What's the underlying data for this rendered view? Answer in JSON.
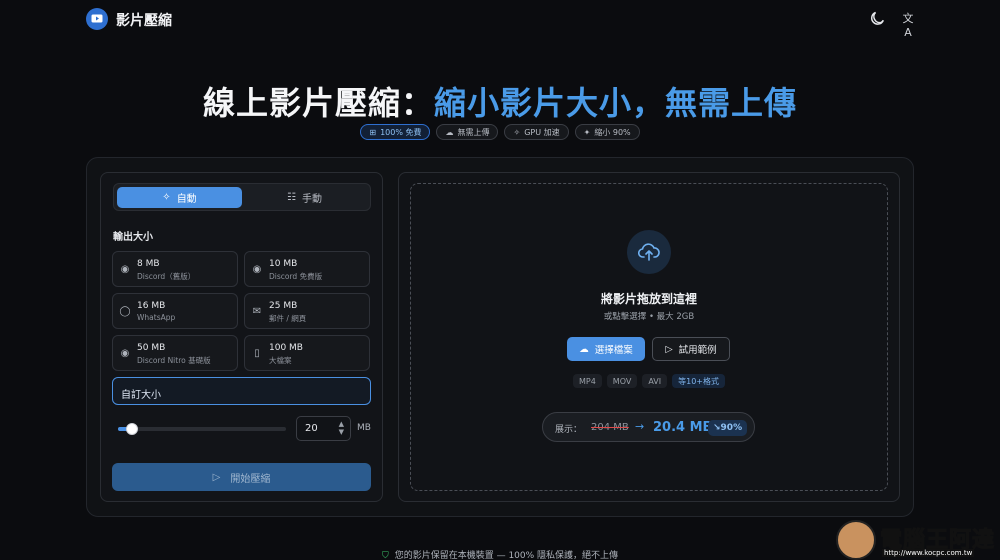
{
  "header": {
    "app_name": "影片壓縮"
  },
  "hero": {
    "title_white": "線上影片壓縮：",
    "title_blue": "縮小影片大小，無需上傳"
  },
  "badges": [
    {
      "icon": "gift-icon",
      "glyph": "⊞",
      "label": "100% 免費"
    },
    {
      "icon": "cloud-off-icon",
      "glyph": "☁",
      "label": "無需上傳"
    },
    {
      "icon": "cpu-icon",
      "glyph": "✧",
      "label": "GPU 加速"
    },
    {
      "icon": "sparkle-icon",
      "glyph": "✦",
      "label": "縮小 90%"
    }
  ],
  "mode": {
    "auto_label": "自動",
    "manual_label": "手動"
  },
  "output": {
    "title": "輸出大小",
    "options": [
      {
        "icon": "discord-icon",
        "glyph": "◉",
        "size": "8 MB",
        "desc": "Discord（舊版）"
      },
      {
        "icon": "discord-icon",
        "glyph": "◉",
        "size": "10 MB",
        "desc": "Discord 免費版"
      },
      {
        "icon": "whatsapp-icon",
        "glyph": "◯",
        "size": "16 MB",
        "desc": "WhatsApp"
      },
      {
        "icon": "mail-icon",
        "glyph": "✉",
        "size": "25 MB",
        "desc": "郵件 / 網頁"
      },
      {
        "icon": "discord-icon",
        "glyph": "◉",
        "size": "50 MB",
        "desc": "Discord Nitro 基礎版"
      },
      {
        "icon": "file-icon",
        "glyph": "▯",
        "size": "100 MB",
        "desc": "大檔案"
      }
    ],
    "custom_label": "自訂大小",
    "slider_value": 20,
    "slider_fraction": 0.05,
    "unit": "MB",
    "start_label": "開始壓縮"
  },
  "dropzone": {
    "title": "將影片拖放到這裡",
    "subtitle": "或點擊選擇 • 最大 2GB",
    "choose_label": "選擇檔案",
    "try_label": "試用範例",
    "formats": [
      "MP4",
      "MOV",
      "AVI"
    ],
    "more_formats": "等10+格式",
    "demo_label": "展示：",
    "demo_from": "204 MB",
    "demo_to": "20.4 MB",
    "demo_pct": "↘90%"
  },
  "footer": {
    "text": "您的影片保留在本機裝置 — 100% 隱私保護，絕不上傳"
  },
  "watermark": {
    "text": "電腦王阿達",
    "url": "http://www.kocpc.com.tw"
  },
  "colors": {
    "accent": "#4a90e2",
    "title_blue": "#4a9be8",
    "background": "#0b0c0f"
  }
}
